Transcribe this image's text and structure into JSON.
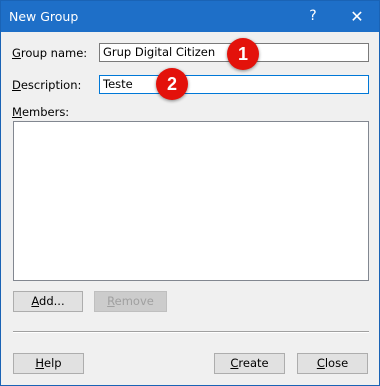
{
  "window": {
    "title": "New Group",
    "help_glyph": "?",
    "close_glyph": "✕"
  },
  "form": {
    "group_name": {
      "label_first": "G",
      "label_rest": "roup name:",
      "value": "Grup Digital Citizen"
    },
    "description": {
      "label_first": "D",
      "label_rest": "escription:",
      "value": "Teste"
    },
    "members": {
      "label_first": "M",
      "label_rest": "embers:"
    }
  },
  "buttons": {
    "add": {
      "first": "A",
      "rest": "dd..."
    },
    "remove": {
      "first": "R",
      "rest": "emove"
    },
    "help": {
      "first": "H",
      "rest": "elp"
    },
    "create": {
      "first": "C",
      "rest": "reate"
    },
    "close": {
      "first": "C",
      "rest": "lose"
    }
  },
  "badges": {
    "one": "1",
    "two": "2"
  },
  "colors": {
    "titlebar": "#1e6fc8",
    "badge": "#e3120b",
    "focus_border": "#0078d7"
  }
}
